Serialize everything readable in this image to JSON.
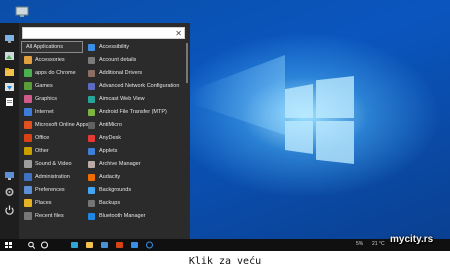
{
  "start_menu": {
    "search_placeholder": "",
    "rail_icons": [
      "monitor-icon",
      "image-icon",
      "folder-icon",
      "download-icon",
      "document-icon",
      "settings-icon",
      "power-icon"
    ],
    "categories": [
      {
        "label": "All Applications",
        "icon": "all-apps-icon",
        "color": "#444444",
        "selected": true
      },
      {
        "label": "Accessories",
        "icon": "accessories-icon",
        "color": "#e0a040"
      },
      {
        "label": "apps do Chrome",
        "icon": "chrome-icon",
        "color": "#4caf50"
      },
      {
        "label": "Games",
        "icon": "games-icon",
        "color": "#5a9e3a"
      },
      {
        "label": "Graphics",
        "icon": "graphics-icon",
        "color": "#d05a8a"
      },
      {
        "label": "Internet",
        "icon": "internet-icon",
        "color": "#3d7fd8"
      },
      {
        "label": "Microsoft Online Apps",
        "icon": "office-icon",
        "color": "#e05020"
      },
      {
        "label": "Office",
        "icon": "office-folder-icon",
        "color": "#d84315"
      },
      {
        "label": "Other",
        "icon": "other-icon",
        "color": "#c9a000"
      },
      {
        "label": "Sound & Video",
        "icon": "sound-video-icon",
        "color": "#9e9e9e"
      },
      {
        "label": "Administration",
        "icon": "administration-icon",
        "color": "#3f72c2"
      },
      {
        "label": "Preferences",
        "icon": "preferences-icon",
        "color": "#5c8fd6"
      },
      {
        "label": "Places",
        "icon": "places-icon",
        "color": "#e6b422"
      },
      {
        "label": "Recent files",
        "icon": "recent-files-icon",
        "color": "#777777"
      }
    ],
    "apps": [
      {
        "label": "Accessibility",
        "icon": "accessibility-icon",
        "color": "#3a8ee6"
      },
      {
        "label": "Account details",
        "icon": "account-icon",
        "color": "#7a7a7a"
      },
      {
        "label": "Additional Drivers",
        "icon": "drivers-icon",
        "color": "#8d6e63"
      },
      {
        "label": "Advanced Network Configuration",
        "icon": "network-icon",
        "color": "#5c6bc0"
      },
      {
        "label": "Aimcast Web View",
        "icon": "aimcast-icon",
        "color": "#26a69a"
      },
      {
        "label": "Android File Transfer (MTP)",
        "icon": "android-icon",
        "color": "#7cb342"
      },
      {
        "label": "AntiMicro",
        "icon": "gamepad-icon",
        "color": "#616161"
      },
      {
        "label": "AnyDesk",
        "icon": "anydesk-icon",
        "color": "#e53935"
      },
      {
        "label": "Applets",
        "icon": "applets-icon",
        "color": "#3d7fd8"
      },
      {
        "label": "Archive Manager",
        "icon": "archive-icon",
        "color": "#bcaaa4"
      },
      {
        "label": "Audacity",
        "icon": "audacity-icon",
        "color": "#ef6c00"
      },
      {
        "label": "Backgrounds",
        "icon": "backgrounds-icon",
        "color": "#42a5f5"
      },
      {
        "label": "Backups",
        "icon": "backups-icon",
        "color": "#757575"
      },
      {
        "label": "Bluetooth Manager",
        "icon": "bluetooth-icon",
        "color": "#1e88e5"
      }
    ]
  },
  "taskbar": {
    "items": [
      {
        "icon": "start-windows-icon",
        "color": "#ffffff"
      },
      {
        "icon": "search-icon",
        "color": "#ffffff"
      },
      {
        "icon": "task-view-icon",
        "color": "#ffffff"
      },
      {
        "icon": "edge-icon",
        "color": "#2ea6d8"
      },
      {
        "icon": "file-explorer-icon",
        "color": "#f2c14e"
      },
      {
        "icon": "store-icon",
        "color": "#4a90d9"
      },
      {
        "icon": "office-icon",
        "color": "#d84315"
      },
      {
        "icon": "onedrive-icon",
        "color": "#3a8ee6"
      },
      {
        "icon": "cortana-icon",
        "color": "#3a8ee6"
      }
    ],
    "tray_battery": "5%",
    "tray_temp": "21 °C"
  },
  "watermark": "mycity.rs",
  "caption": "Klik za veću"
}
